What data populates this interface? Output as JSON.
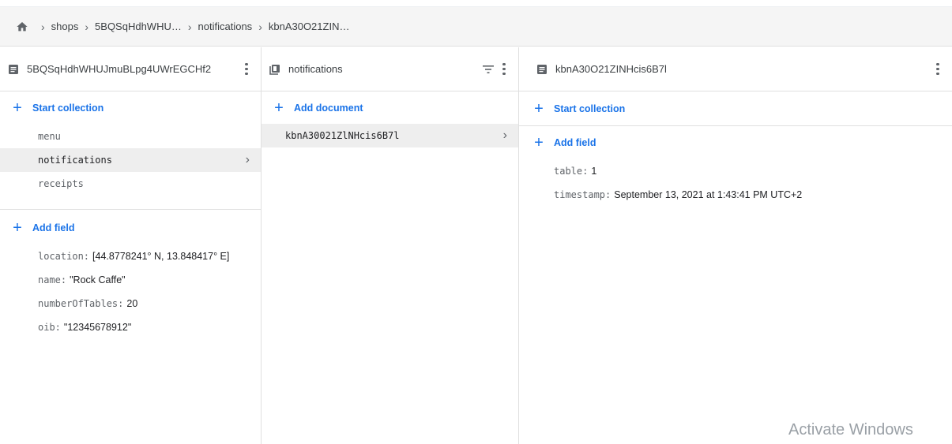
{
  "breadcrumb": {
    "items": [
      "shops",
      "5BQSqHdhWHU…",
      "notifications",
      "kbnA30O21ZIN…"
    ]
  },
  "panel_collection_parent": {
    "title": "5BQSqHdhWHUJmuBLpg4UWrEGCHf2",
    "start_collection": "Start collection",
    "collections": [
      "menu",
      "notifications",
      "receipts"
    ],
    "selected": "notifications",
    "add_field": "Add field",
    "fields": [
      {
        "key": "location:",
        "value": "[44.8778241° N, 13.848417° E]"
      },
      {
        "key": "name:",
        "value": "\"Rock Caffe\""
      },
      {
        "key": "numberOfTables:",
        "value": "20"
      },
      {
        "key": "oib:",
        "value": "\"12345678912\""
      }
    ]
  },
  "panel_collection": {
    "title": "notifications",
    "add_document": "Add document",
    "documents": [
      "kbnA30021ZlNHcis6B7l"
    ]
  },
  "panel_document": {
    "title": "kbnA30O21ZINHcis6B7l",
    "start_collection": "Start collection",
    "add_field": "Add field",
    "fields": [
      {
        "key": "table:",
        "value": "1"
      },
      {
        "key": "timestamp:",
        "value": "September 13, 2021 at 1:43:41 PM UTC+2"
      }
    ]
  },
  "watermark": "Activate Windows",
  "colors": {
    "accent": "#1a73e8",
    "selected_bg": "#eeeeee",
    "header_bg": "#f5f5f5"
  }
}
